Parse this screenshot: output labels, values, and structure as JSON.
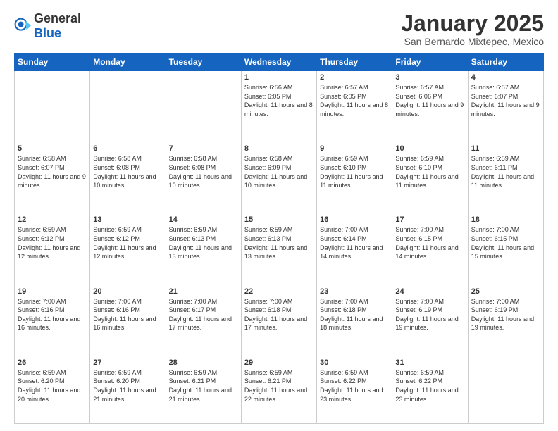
{
  "header": {
    "logo": {
      "text_general": "General",
      "text_blue": "Blue"
    },
    "title": "January 2025",
    "subtitle": "San Bernardo Mixtepec, Mexico"
  },
  "weekdays": [
    "Sunday",
    "Monday",
    "Tuesday",
    "Wednesday",
    "Thursday",
    "Friday",
    "Saturday"
  ],
  "weeks": [
    [
      {
        "day": "",
        "info": ""
      },
      {
        "day": "",
        "info": ""
      },
      {
        "day": "",
        "info": ""
      },
      {
        "day": "1",
        "info": "Sunrise: 6:56 AM\nSunset: 6:05 PM\nDaylight: 11 hours and 8 minutes."
      },
      {
        "day": "2",
        "info": "Sunrise: 6:57 AM\nSunset: 6:05 PM\nDaylight: 11 hours and 8 minutes."
      },
      {
        "day": "3",
        "info": "Sunrise: 6:57 AM\nSunset: 6:06 PM\nDaylight: 11 hours and 9 minutes."
      },
      {
        "day": "4",
        "info": "Sunrise: 6:57 AM\nSunset: 6:07 PM\nDaylight: 11 hours and 9 minutes."
      }
    ],
    [
      {
        "day": "5",
        "info": "Sunrise: 6:58 AM\nSunset: 6:07 PM\nDaylight: 11 hours and 9 minutes."
      },
      {
        "day": "6",
        "info": "Sunrise: 6:58 AM\nSunset: 6:08 PM\nDaylight: 11 hours and 10 minutes."
      },
      {
        "day": "7",
        "info": "Sunrise: 6:58 AM\nSunset: 6:08 PM\nDaylight: 11 hours and 10 minutes."
      },
      {
        "day": "8",
        "info": "Sunrise: 6:58 AM\nSunset: 6:09 PM\nDaylight: 11 hours and 10 minutes."
      },
      {
        "day": "9",
        "info": "Sunrise: 6:59 AM\nSunset: 6:10 PM\nDaylight: 11 hours and 11 minutes."
      },
      {
        "day": "10",
        "info": "Sunrise: 6:59 AM\nSunset: 6:10 PM\nDaylight: 11 hours and 11 minutes."
      },
      {
        "day": "11",
        "info": "Sunrise: 6:59 AM\nSunset: 6:11 PM\nDaylight: 11 hours and 11 minutes."
      }
    ],
    [
      {
        "day": "12",
        "info": "Sunrise: 6:59 AM\nSunset: 6:12 PM\nDaylight: 11 hours and 12 minutes."
      },
      {
        "day": "13",
        "info": "Sunrise: 6:59 AM\nSunset: 6:12 PM\nDaylight: 11 hours and 12 minutes."
      },
      {
        "day": "14",
        "info": "Sunrise: 6:59 AM\nSunset: 6:13 PM\nDaylight: 11 hours and 13 minutes."
      },
      {
        "day": "15",
        "info": "Sunrise: 6:59 AM\nSunset: 6:13 PM\nDaylight: 11 hours and 13 minutes."
      },
      {
        "day": "16",
        "info": "Sunrise: 7:00 AM\nSunset: 6:14 PM\nDaylight: 11 hours and 14 minutes."
      },
      {
        "day": "17",
        "info": "Sunrise: 7:00 AM\nSunset: 6:15 PM\nDaylight: 11 hours and 14 minutes."
      },
      {
        "day": "18",
        "info": "Sunrise: 7:00 AM\nSunset: 6:15 PM\nDaylight: 11 hours and 15 minutes."
      }
    ],
    [
      {
        "day": "19",
        "info": "Sunrise: 7:00 AM\nSunset: 6:16 PM\nDaylight: 11 hours and 16 minutes."
      },
      {
        "day": "20",
        "info": "Sunrise: 7:00 AM\nSunset: 6:16 PM\nDaylight: 11 hours and 16 minutes."
      },
      {
        "day": "21",
        "info": "Sunrise: 7:00 AM\nSunset: 6:17 PM\nDaylight: 11 hours and 17 minutes."
      },
      {
        "day": "22",
        "info": "Sunrise: 7:00 AM\nSunset: 6:18 PM\nDaylight: 11 hours and 17 minutes."
      },
      {
        "day": "23",
        "info": "Sunrise: 7:00 AM\nSunset: 6:18 PM\nDaylight: 11 hours and 18 minutes."
      },
      {
        "day": "24",
        "info": "Sunrise: 7:00 AM\nSunset: 6:19 PM\nDaylight: 11 hours and 19 minutes."
      },
      {
        "day": "25",
        "info": "Sunrise: 7:00 AM\nSunset: 6:19 PM\nDaylight: 11 hours and 19 minutes."
      }
    ],
    [
      {
        "day": "26",
        "info": "Sunrise: 6:59 AM\nSunset: 6:20 PM\nDaylight: 11 hours and 20 minutes."
      },
      {
        "day": "27",
        "info": "Sunrise: 6:59 AM\nSunset: 6:20 PM\nDaylight: 11 hours and 21 minutes."
      },
      {
        "day": "28",
        "info": "Sunrise: 6:59 AM\nSunset: 6:21 PM\nDaylight: 11 hours and 21 minutes."
      },
      {
        "day": "29",
        "info": "Sunrise: 6:59 AM\nSunset: 6:21 PM\nDaylight: 11 hours and 22 minutes."
      },
      {
        "day": "30",
        "info": "Sunrise: 6:59 AM\nSunset: 6:22 PM\nDaylight: 11 hours and 23 minutes."
      },
      {
        "day": "31",
        "info": "Sunrise: 6:59 AM\nSunset: 6:22 PM\nDaylight: 11 hours and 23 minutes."
      },
      {
        "day": "",
        "info": ""
      }
    ]
  ]
}
